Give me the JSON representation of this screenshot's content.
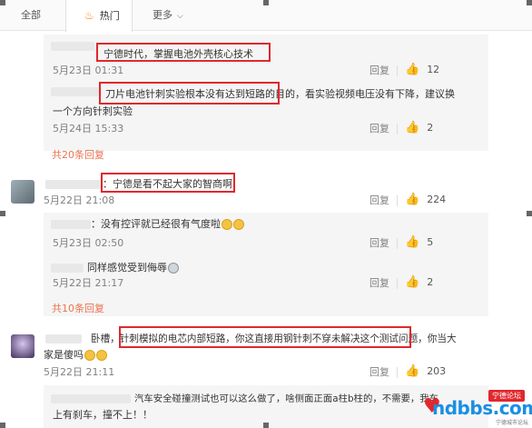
{
  "tabs": [
    {
      "label": "全部"
    },
    {
      "label": "热门"
    },
    {
      "label": "更多"
    }
  ],
  "comments": [
    {
      "text": "宁德时代，掌握电池外壳核心技术",
      "time": "5月23日 01:31",
      "reply": "回复",
      "likes": "12"
    },
    {
      "text": "刀片电池针刺实验根本没有达到短路的目的，看实验视频电压没有下降，建议换",
      "text2": "一个方向针刺实验",
      "time": "5月24日 15:33",
      "reply": "回复",
      "likes": "2"
    },
    {
      "more": "共20条回复"
    },
    {
      "text": "：宁德是看不起大家的智商啊",
      "time": "5月22日 21:08",
      "reply": "回复",
      "likes": "224"
    },
    {
      "text": "：没有控评就已经很有气度啦",
      "time": "5月23日 02:50",
      "reply": "回复",
      "likes": "5"
    },
    {
      "text": "同样感觉受到侮辱",
      "time": "5月22日 21:17",
      "reply": "回复",
      "likes": "2"
    },
    {
      "more": "共10条回复"
    },
    {
      "text": "卧槽，针刺模拟的电芯内部短路，你这直接用钢针刺不穿未解决这个测试问题，你当大",
      "text2": "家是傻吗",
      "time": "5月22日 21:11",
      "reply": "回复",
      "likes": "203"
    },
    {
      "text": "汽车安全碰撞测试也可以这么做了，啥侧面正面a柱b柱的，不需要，我车",
      "text2": "上有刹车，撞不上！！"
    }
  ],
  "watermark": {
    "main": "ndbbs.com",
    "badge": "宁德论坛",
    "sub": "宁德城市论坛"
  }
}
